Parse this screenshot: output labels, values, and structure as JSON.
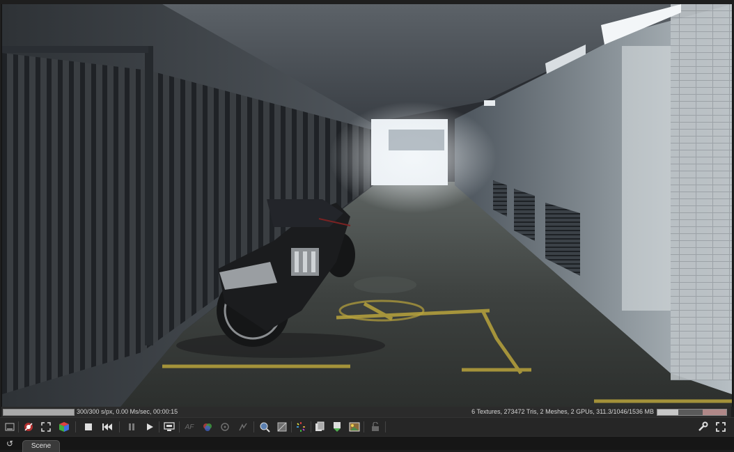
{
  "status": {
    "left_text": "300/300 s/px, 0.00 Ms/sec, 00:00:15",
    "right_text": "6 Textures, 273472 Tris, 2 Meshes, 2 GPUs, 311.3/1046/1536 MB",
    "render_progress": 1.0,
    "memory_usage": 0.3
  },
  "toolbar": {
    "buttons": [
      {
        "name": "render-region-icon"
      },
      {
        "name": "reset-camera-icon"
      },
      {
        "name": "fit-view-icon"
      },
      {
        "name": "color-cube-icon"
      },
      {
        "name": "stop-render-icon"
      },
      {
        "name": "restart-render-icon"
      },
      {
        "name": "pause-render-icon"
      },
      {
        "name": "start-render-icon"
      },
      {
        "name": "display-settings-icon"
      },
      {
        "name": "autofocus-icon"
      },
      {
        "name": "material-picker-icon"
      },
      {
        "name": "object-picker-icon"
      },
      {
        "name": "focus-picker-icon"
      },
      {
        "name": "lock-view-icon"
      },
      {
        "name": "clay-mode-icon"
      },
      {
        "name": "subsampling-icon"
      },
      {
        "name": "copy-render-icon"
      },
      {
        "name": "save-render-icon"
      },
      {
        "name": "save-image-icon"
      },
      {
        "name": "lock-icon"
      },
      {
        "name": "settings-wrench-icon"
      },
      {
        "name": "fullscreen-icon"
      }
    ],
    "af_label": "AF"
  },
  "tabs": [
    {
      "label": "Scene",
      "active": true
    }
  ]
}
